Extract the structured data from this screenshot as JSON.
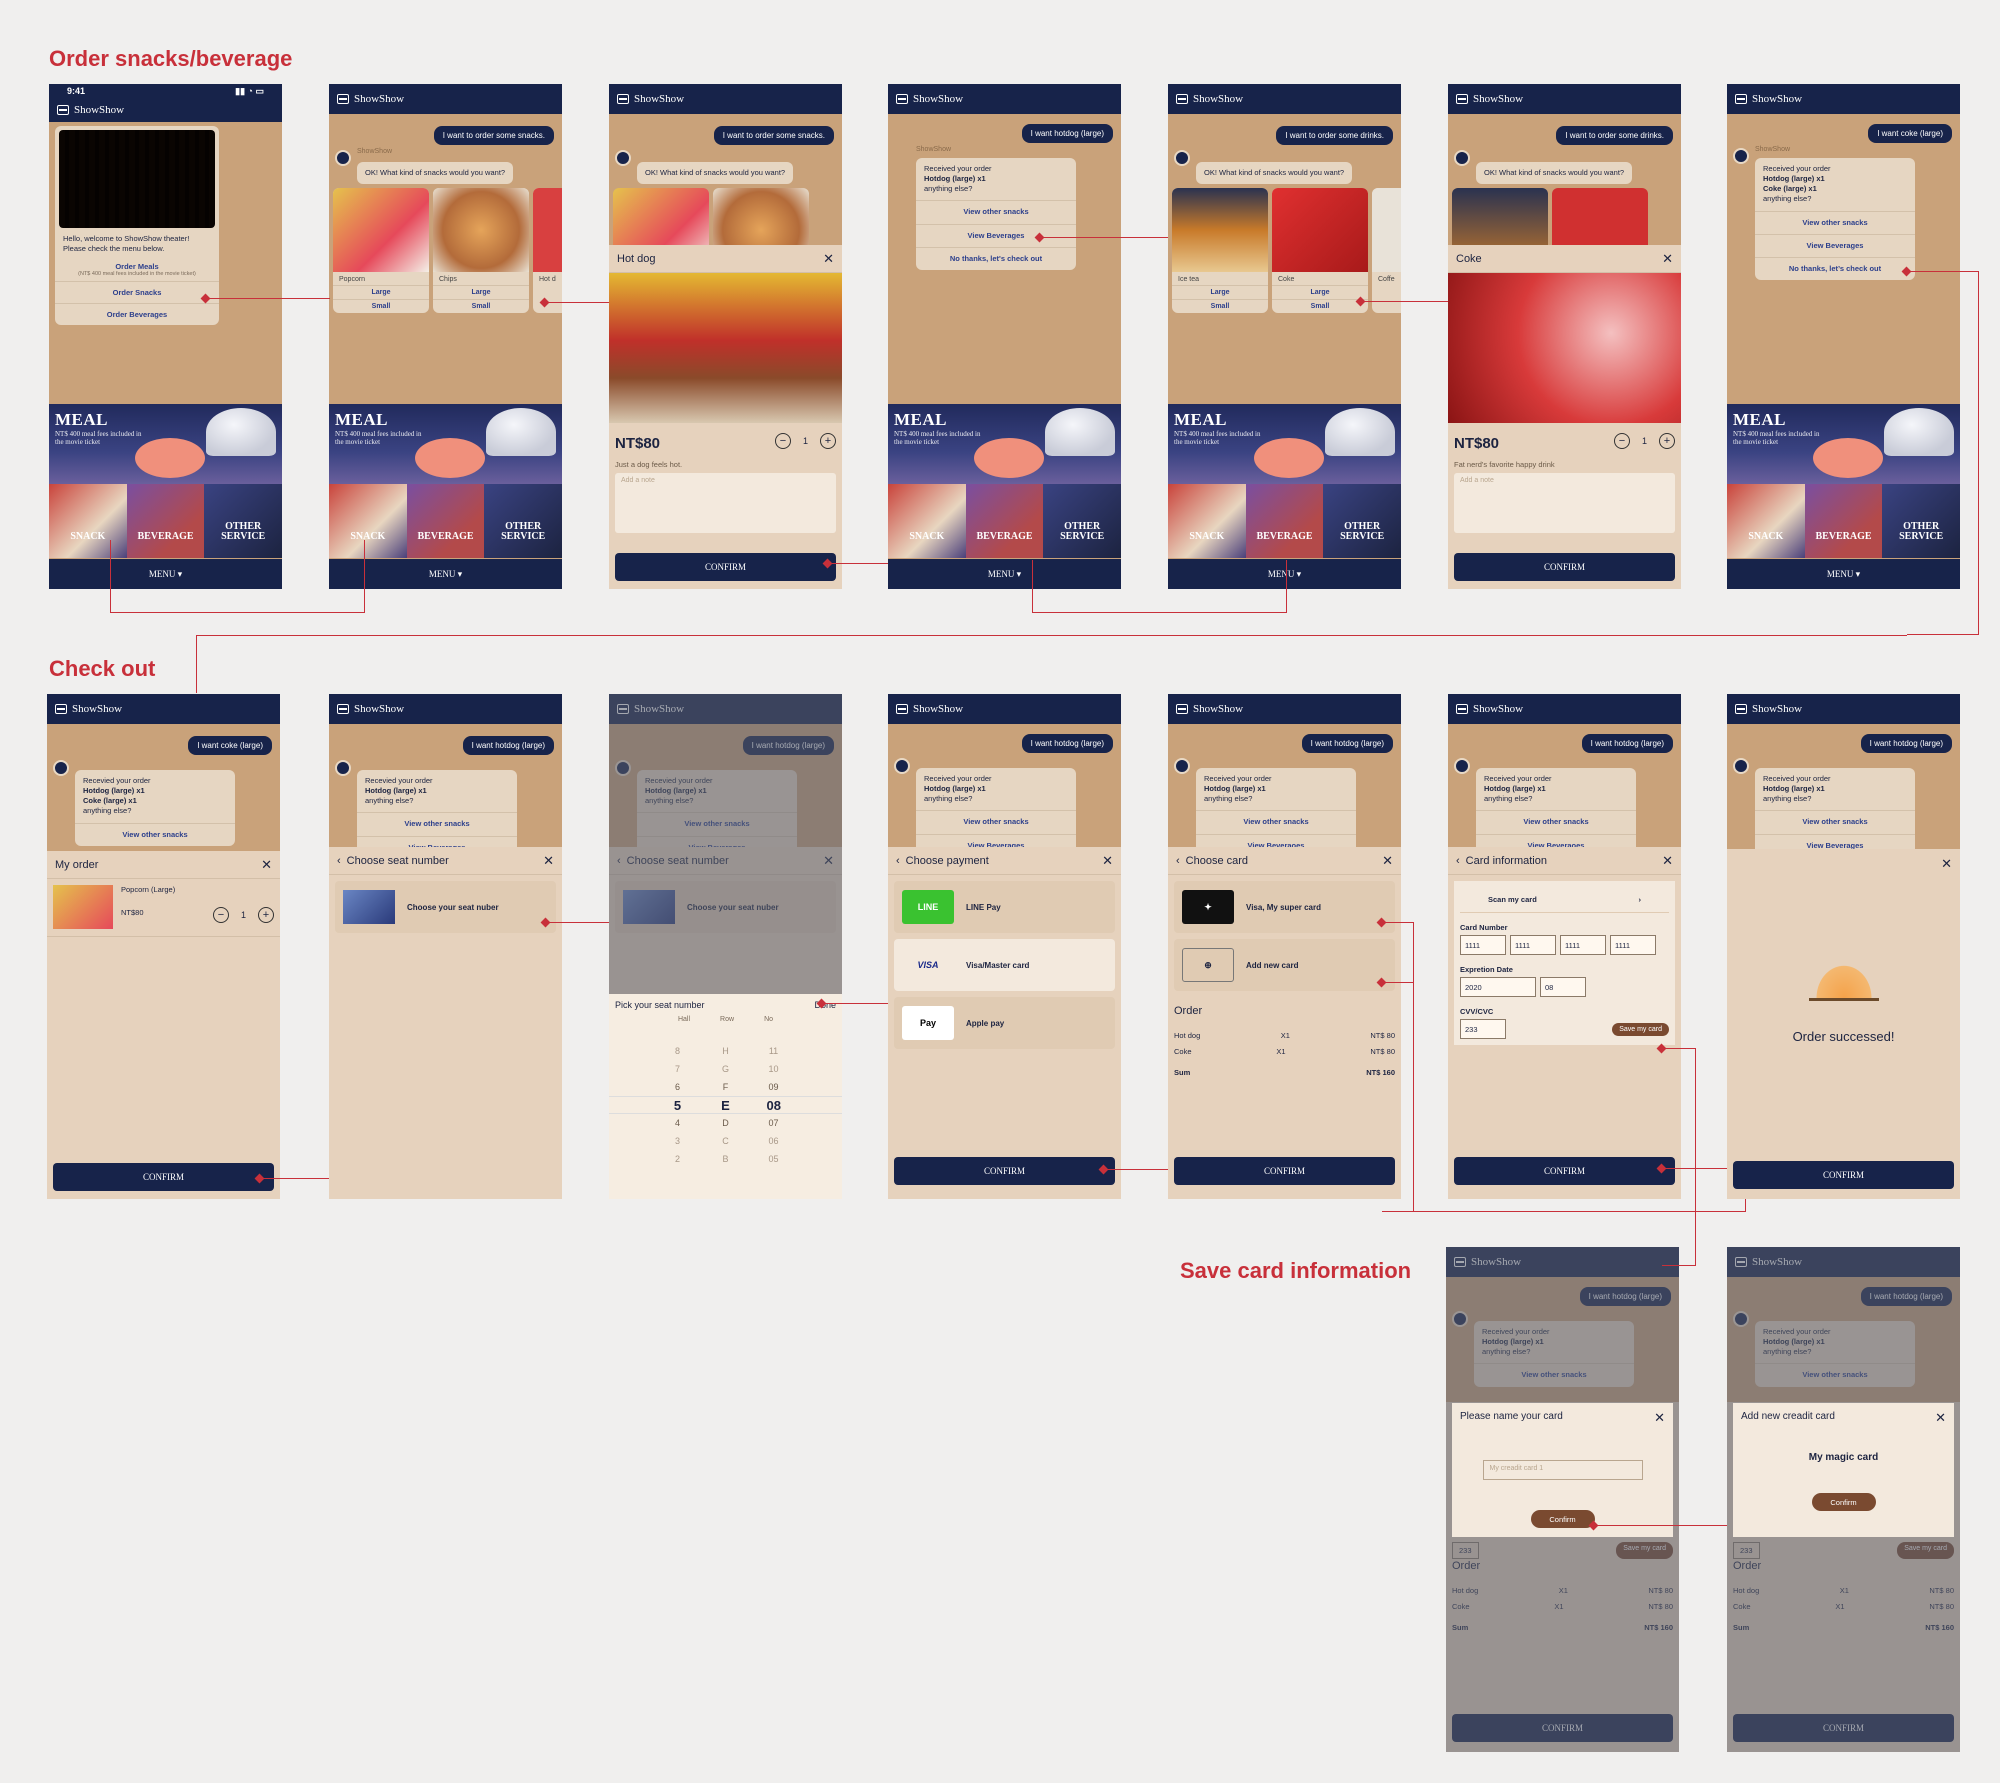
{
  "sections": {
    "order": "Order snacks/beverage",
    "checkout": "Check out",
    "save": "Save card information"
  },
  "app": {
    "name": "ShowShow",
    "time": "9:41",
    "menu": "MENU ▾",
    "meal_title": "MEAL",
    "meal_sub": "NT$ 400 meal fees included in the movie ticket",
    "tiles": [
      "SNACK",
      "BEVERAGE",
      "OTHER SERVICE"
    ],
    "confirm": "CONFIRM"
  },
  "welcome": {
    "greeting": "Hello, welcome to ShowShow theater! Please check the menu below.",
    "order_meals": "Order Meals",
    "meal_note": "(NT$ 400 meal fees included in the movie ticket)",
    "order_snacks": "Order Snacks",
    "order_beverages": "Order Beverages"
  },
  "chat": {
    "want_snacks": "I want to order some snacks.",
    "want_drinks": "I want to order some drinks.",
    "want_hotdog": "I want hotdog (large)",
    "want_coke": "I want coke (large)",
    "ask_snacks": "OK! What kind of snacks would you want?",
    "received": "Received your order",
    "recevied": "Recevied your order",
    "hotdog_line": "Hotdog (large) x1",
    "coke_line": "Coke (large) x1",
    "anything": "anything else?",
    "view_snacks": "View other snacks",
    "view_bev": "View Beverages",
    "view_bev_alt": "View Beveraoes",
    "checkout": "No thanks, let's check out",
    "checkout_alt": "No thanks, let’s check out"
  },
  "products": {
    "snacks": [
      {
        "name": "Popcorn",
        "large": "Large",
        "small": "Small"
      },
      {
        "name": "Chips",
        "large": "Large",
        "small": "Small"
      },
      {
        "name": "Hot d"
      }
    ],
    "drinks": [
      {
        "name": "Ice tea",
        "large": "Large",
        "small": "Small"
      },
      {
        "name": "Coke",
        "large": "Large",
        "small": "Small"
      },
      {
        "name": "Coffe"
      }
    ]
  },
  "hotdog": {
    "title": "Hot dog",
    "price": "NT$80",
    "qty": "1",
    "desc": "Just a dog feels hot.",
    "note": "Add a note"
  },
  "coke": {
    "title": "Coke",
    "price": "NT$80",
    "qty": "1",
    "desc": "Fat nerd's favorite happy drink",
    "note": "Add a note"
  },
  "myorder": {
    "title": "My order",
    "item": "Popcorn (Large)",
    "price": "NT$80",
    "qty": "1"
  },
  "seat": {
    "title": "Choose seat number",
    "item": "Choose your seat nuber",
    "pick": "Pick your seat number",
    "done": "Done",
    "cols": [
      "Hall",
      "Row",
      "No"
    ],
    "rows": [
      [
        "8",
        "H",
        "11"
      ],
      [
        "7",
        "G",
        "10"
      ],
      [
        "6",
        "F",
        "09"
      ],
      [
        "5",
        "E",
        "08"
      ],
      [
        "4",
        "D",
        "07"
      ],
      [
        "3",
        "C",
        "06"
      ],
      [
        "2",
        "B",
        "05"
      ]
    ]
  },
  "payment": {
    "title": "Choose payment",
    "line": "LINE Pay",
    "visa": "Visa/Master card",
    "apple": "Apple pay",
    "line_logo": "LINE",
    "visa_logo": "VISA",
    "apple_logo": " Pay"
  },
  "choosecard": {
    "title": "Choose card",
    "card": "Visa, My super card",
    "add": "Add new card"
  },
  "order": {
    "label": "Order",
    "rows": [
      [
        "Hot dog",
        "X1",
        "NT$ 80"
      ],
      [
        "Coke",
        "X1",
        "NT$ 80"
      ]
    ],
    "sum_label": "Sum",
    "sum": "NT$ 160"
  },
  "cardinfo": {
    "title": "Card information",
    "scan": "Scan my card",
    "number_label": "Card Number",
    "number": [
      "1111",
      "1111",
      "1111",
      "1111"
    ],
    "exp_label": "Expretion Date",
    "year": "2020",
    "month": "08",
    "cvv_label": "CVV/CVC",
    "cvv": "233",
    "save": "Save my card"
  },
  "success": {
    "text": "Order successed!"
  },
  "namecard": {
    "title": "Please name your card",
    "placeholder": "My creadit card 1",
    "confirm": "Confirm"
  },
  "newcard": {
    "title": "Add new creadit card",
    "name": "My magic card",
    "confirm": "Confirm"
  }
}
